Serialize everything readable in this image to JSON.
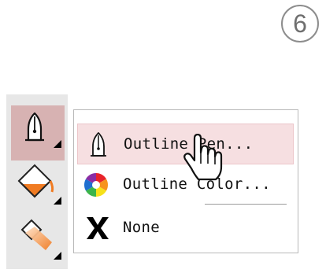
{
  "step": {
    "number": "6"
  },
  "toolbox": {
    "buttons": [
      {
        "name": "outline-tool",
        "active": true
      },
      {
        "name": "fill-tool",
        "active": false
      },
      {
        "name": "interactive-fill-tool",
        "active": false
      }
    ]
  },
  "flyout": {
    "items": [
      {
        "label": "Outline Pen...",
        "icon": "pen-nib-icon",
        "highlighted": true
      },
      {
        "label": "Outline Color...",
        "icon": "color-wheel-icon",
        "highlighted": false
      },
      {
        "label": "None",
        "icon": "x-icon",
        "highlighted": false
      }
    ]
  },
  "colors": {
    "active_tool_bg": "#d7b2b2",
    "highlight_bg": "#f6dfe1",
    "fill_orange": "#f07b22",
    "toolbox_bg": "#e7e7e7"
  },
  "cursor": {
    "icon": "hand-pointer-icon"
  }
}
